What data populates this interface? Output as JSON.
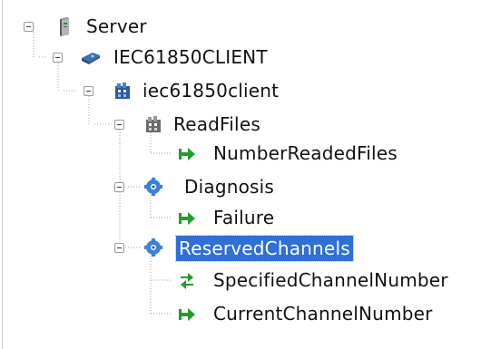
{
  "tree": {
    "root": {
      "label": "Server",
      "icon": "server-icon",
      "children": {
        "client_ied": {
          "label": "IEC61850CLIENT",
          "icon": "device-icon",
          "ld": {
            "label": "iec61850client",
            "icon": "logical-device-icon",
            "nodes": [
              {
                "label": "ReadFiles",
                "icon": "logical-node-icon",
                "items": [
                  {
                    "label": "NumberReadedFiles",
                    "icon": "data-arrow-icon"
                  }
                ]
              },
              {
                "label": "Diagnosis",
                "icon": "logical-node-blue-icon",
                "items": [
                  {
                    "label": "Failure",
                    "icon": "data-arrow-icon"
                  }
                ]
              },
              {
                "label": "ReservedChannels",
                "icon": "logical-node-blue-icon",
                "selected": true,
                "items": [
                  {
                    "label": "SpecifiedChannelNumber",
                    "icon": "bidirectional-arrow-icon"
                  },
                  {
                    "label": "CurrentChannelNumber",
                    "icon": "data-arrow-icon"
                  }
                ]
              }
            ]
          }
        }
      }
    }
  },
  "colors": {
    "selection": "#2f6fd6",
    "arrow": "#1f9e2c",
    "guide": "#a0a0a0"
  }
}
